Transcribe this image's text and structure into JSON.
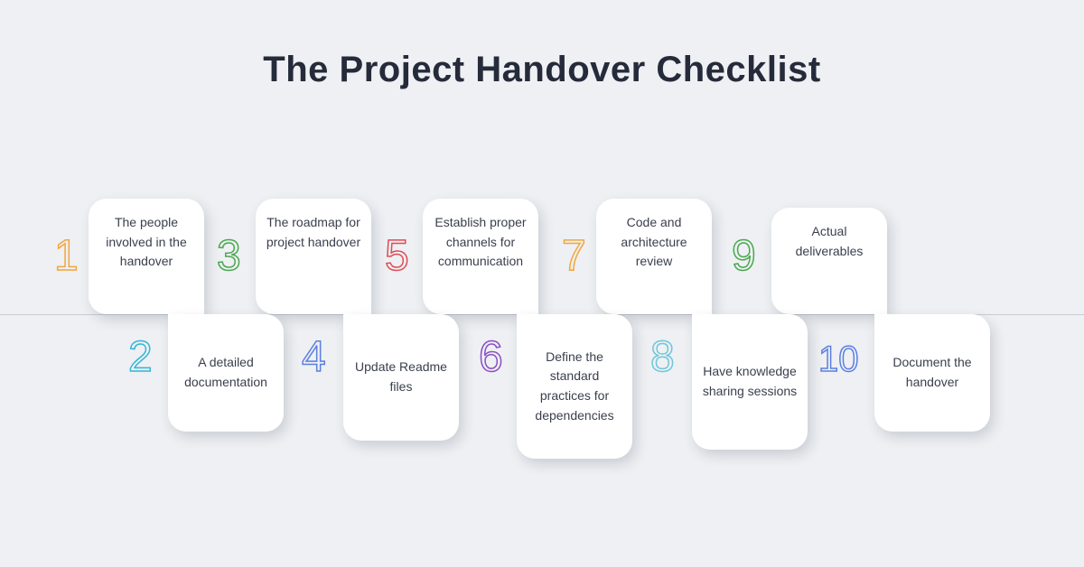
{
  "title": "The Project Handover Checklist",
  "items": [
    {
      "n": "1",
      "label": "The people involved in the handover"
    },
    {
      "n": "2",
      "label": "A detailed documentation"
    },
    {
      "n": "3",
      "label": "The roadmap for project handover"
    },
    {
      "n": "4",
      "label": "Update Readme files"
    },
    {
      "n": "5",
      "label": "Establish proper channels for communication"
    },
    {
      "n": "6",
      "label": "Define the standard practices for dependencies"
    },
    {
      "n": "7",
      "label": "Code and architecture review"
    },
    {
      "n": "8",
      "label": "Have knowledge sharing sessions"
    },
    {
      "n": "9",
      "label": "Actual deliverables"
    },
    {
      "n": "10",
      "label": "Document the handover"
    }
  ],
  "colors": {
    "1": "#f2a63c",
    "2": "#33b6d6",
    "3": "#4aa84e",
    "4": "#5b7fe0",
    "5": "#e04a55",
    "6": "#8a4fc4",
    "7": "#f2a63c",
    "8": "#6ec7da",
    "9": "#4aa84e",
    "10": "#5b7fe0"
  }
}
